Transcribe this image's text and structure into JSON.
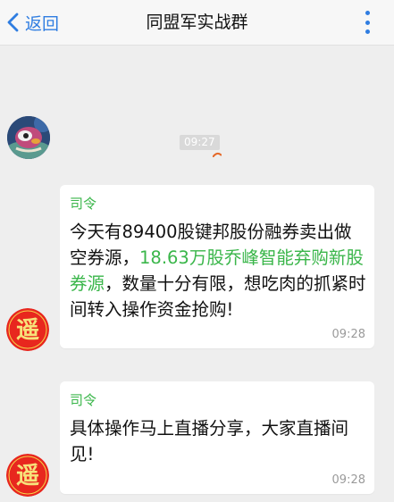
{
  "header": {
    "back_label": "返回",
    "title": "同盟军实战群"
  },
  "chat": {
    "time_chip": "09:27",
    "messages": [
      {
        "sender": "司令",
        "text_before": "今天有89400股键邦股份融券卖出做空券源，",
        "highlight": "18.63万股乔峰智能弃购新股券源",
        "text_after": "，数量十分有限，想吃肉的抓紧时间转入操作资金抢购!",
        "time": "09:28"
      },
      {
        "sender": "司令",
        "text": "具体操作马上直播分享，大家直播间见!",
        "time": "09:28"
      }
    ]
  },
  "colors": {
    "accent_blue": "#2f7de1",
    "sender_green": "#3ab64a",
    "avatar_red": "#e8271e"
  },
  "icons": {
    "back": "chevron-left-icon",
    "more": "more-vertical-icon"
  }
}
